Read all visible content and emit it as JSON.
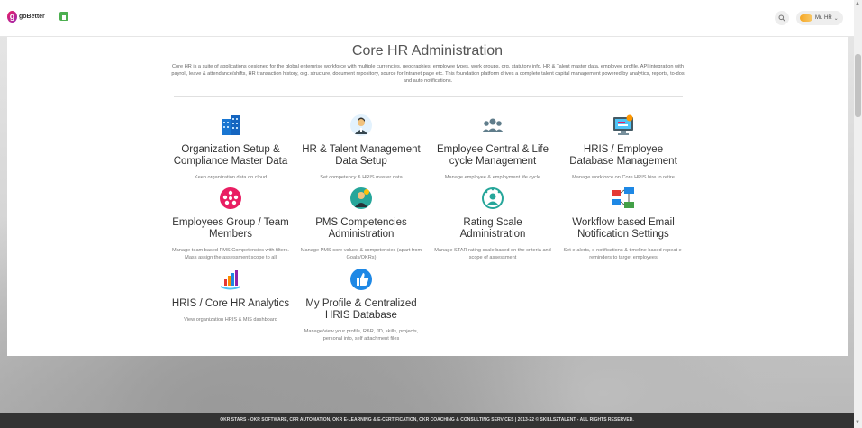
{
  "header": {
    "logo_text": "goBetter",
    "user_name": "Mr. HR"
  },
  "page": {
    "title": "Core HR Administration",
    "description": "Core HR is a suite of applications designed for the global enterprise workforce with multiple currencies, geographies, employee types, work groups, org. statutory info, HR & Talent master data, employee profile, API integration with payroll, leave & attendance/shifts, HR transaction history, org. structure, document repository, source for Intranet page etc. This foundation platform drives a complete talent capital management powered by analytics, reports, to-dos and auto notifications."
  },
  "cards": [
    {
      "title": "Organization Setup & Compliance Master Data",
      "desc": "Keep organization data on cloud",
      "icon": "building-icon"
    },
    {
      "title": "HR & Talent Management Data Setup",
      "desc": "Set competency & HRIS master data",
      "icon": "hr-person-icon"
    },
    {
      "title": "Employee Central & Life cycle Management",
      "desc": "Manage employee & employment life cycle",
      "icon": "team-icon"
    },
    {
      "title": "HRIS / Employee Database Management",
      "desc": "Manage workforce on Core HRIS hire to retire",
      "icon": "database-monitor-icon"
    },
    {
      "title": "Employees Group / Team Members",
      "desc": "Manage team based PMS Competencies with filters. Mass assign the assessment scope to all",
      "icon": "group-circle-icon"
    },
    {
      "title": "PMS Competencies Administration",
      "desc": "Manage PMS core values & competencies (apart from Goals/OKRs)",
      "icon": "competency-icon"
    },
    {
      "title": "Rating Scale Administration",
      "desc": "Manage STAR rating scale based on the criteria and scope of assessment",
      "icon": "rating-icon"
    },
    {
      "title": "Workflow based Email Notification Settings",
      "desc": "Set e-alerts, e-notifications & timeline based repeat e-reminders to target employees",
      "icon": "workflow-email-icon"
    },
    {
      "title": "HRIS / Core HR Analytics",
      "desc": "View organization HRIS & MIS dashboard",
      "icon": "analytics-icon"
    },
    {
      "title": "My Profile & Centralized HRIS Database",
      "desc": "Manage/view your profile, R&R, JD, skills, projects, personal info, self attachment files",
      "icon": "thumbs-up-icon"
    }
  ],
  "footer": {
    "text": "OKR STARS - OKR SOFTWARE, CFR AUTOMATION, OKR E-LEARNING & E-CERTIFICATION, OKR COACHING & CONSULTING SERVICES | 2013-22 © SKILLS2TALENT - ALL RIGHTS RESERVED."
  }
}
